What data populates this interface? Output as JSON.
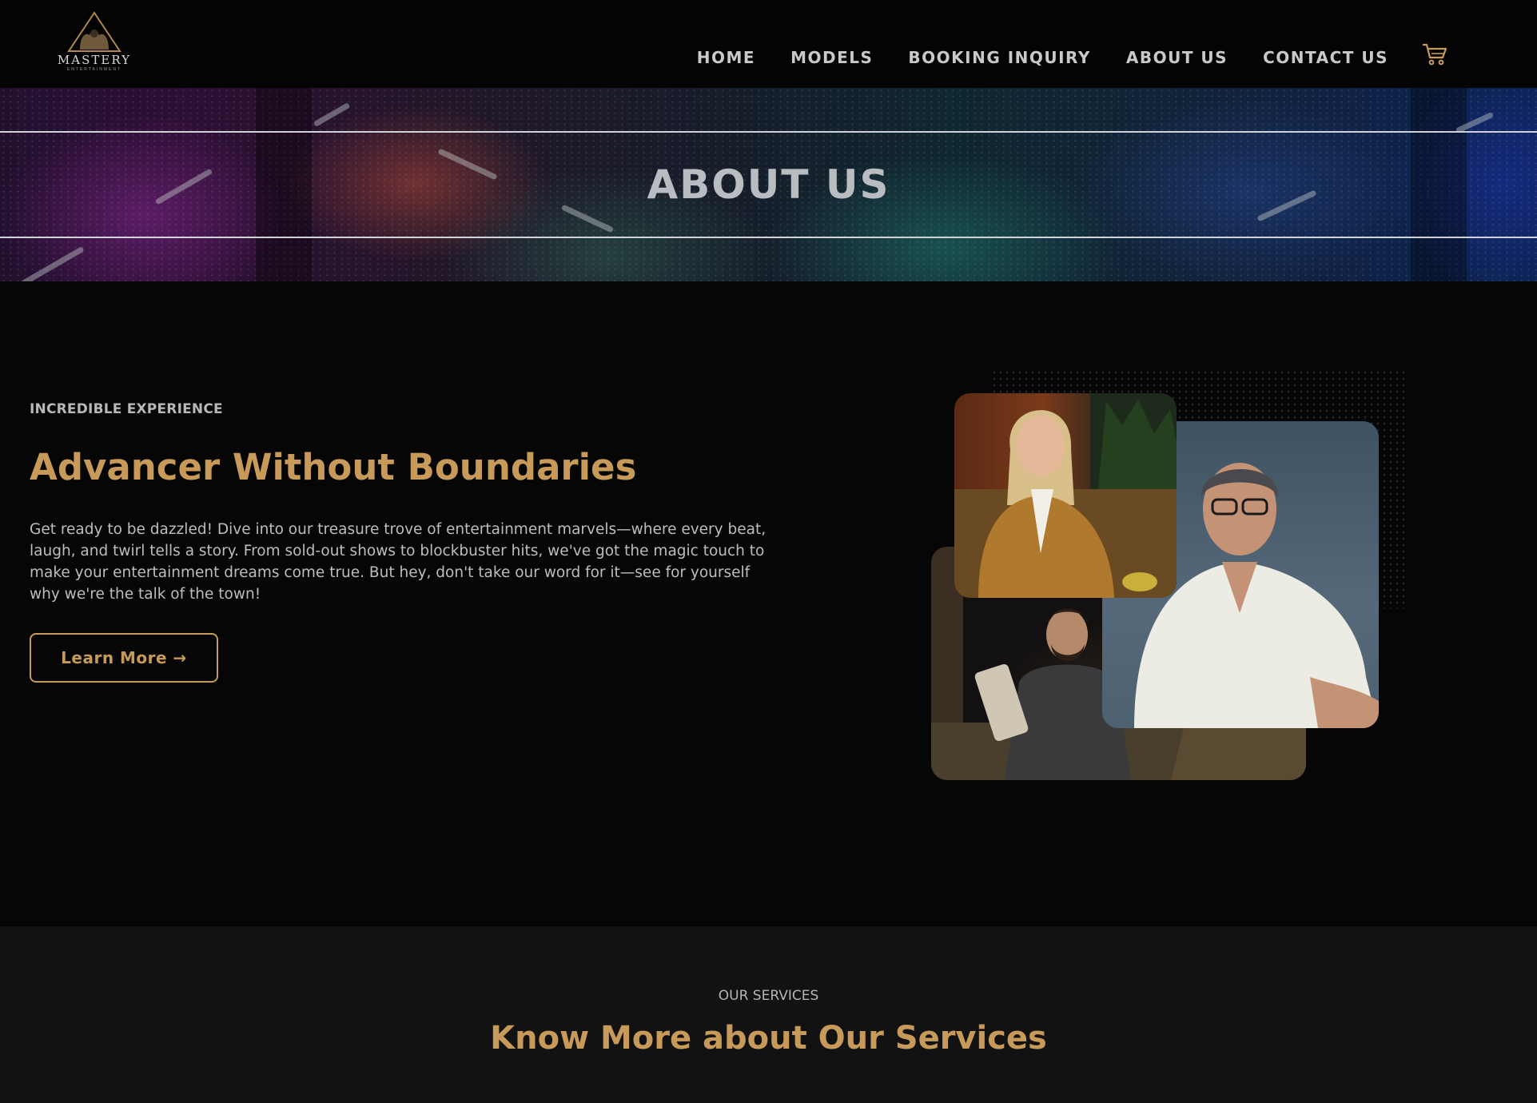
{
  "header": {
    "logo_text": "MASTERY",
    "logo_subtext": "ENTERTAINMENT",
    "nav": [
      {
        "label": "HOME"
      },
      {
        "label": "MODELS"
      },
      {
        "label": "BOOKING INQUIRY"
      },
      {
        "label": "ABOUT US"
      },
      {
        "label": "CONTACT US"
      }
    ],
    "cart_icon": "shopping-cart-icon"
  },
  "hero": {
    "title": "ABOUT US"
  },
  "about": {
    "eyebrow": "INCREDIBLE EXPERIENCE",
    "title": "Advancer Without Boundaries",
    "text": "Get ready to be dazzled! Dive into our treasure trove of entertainment marvels—where every beat, laugh, and twirl tells a story. From sold-out shows to blockbuster hits, we've got the magic touch to make your entertainment dreams come true. But hey, don't take our word for it—see for yourself why we're the talk of the town!",
    "button_label": "Learn More →"
  },
  "services": {
    "eyebrow": "OUR SERVICES",
    "title": "Know More about Our Services"
  },
  "colors": {
    "accent": "#c89a5a",
    "background": "#060606",
    "services_background": "#121212"
  }
}
